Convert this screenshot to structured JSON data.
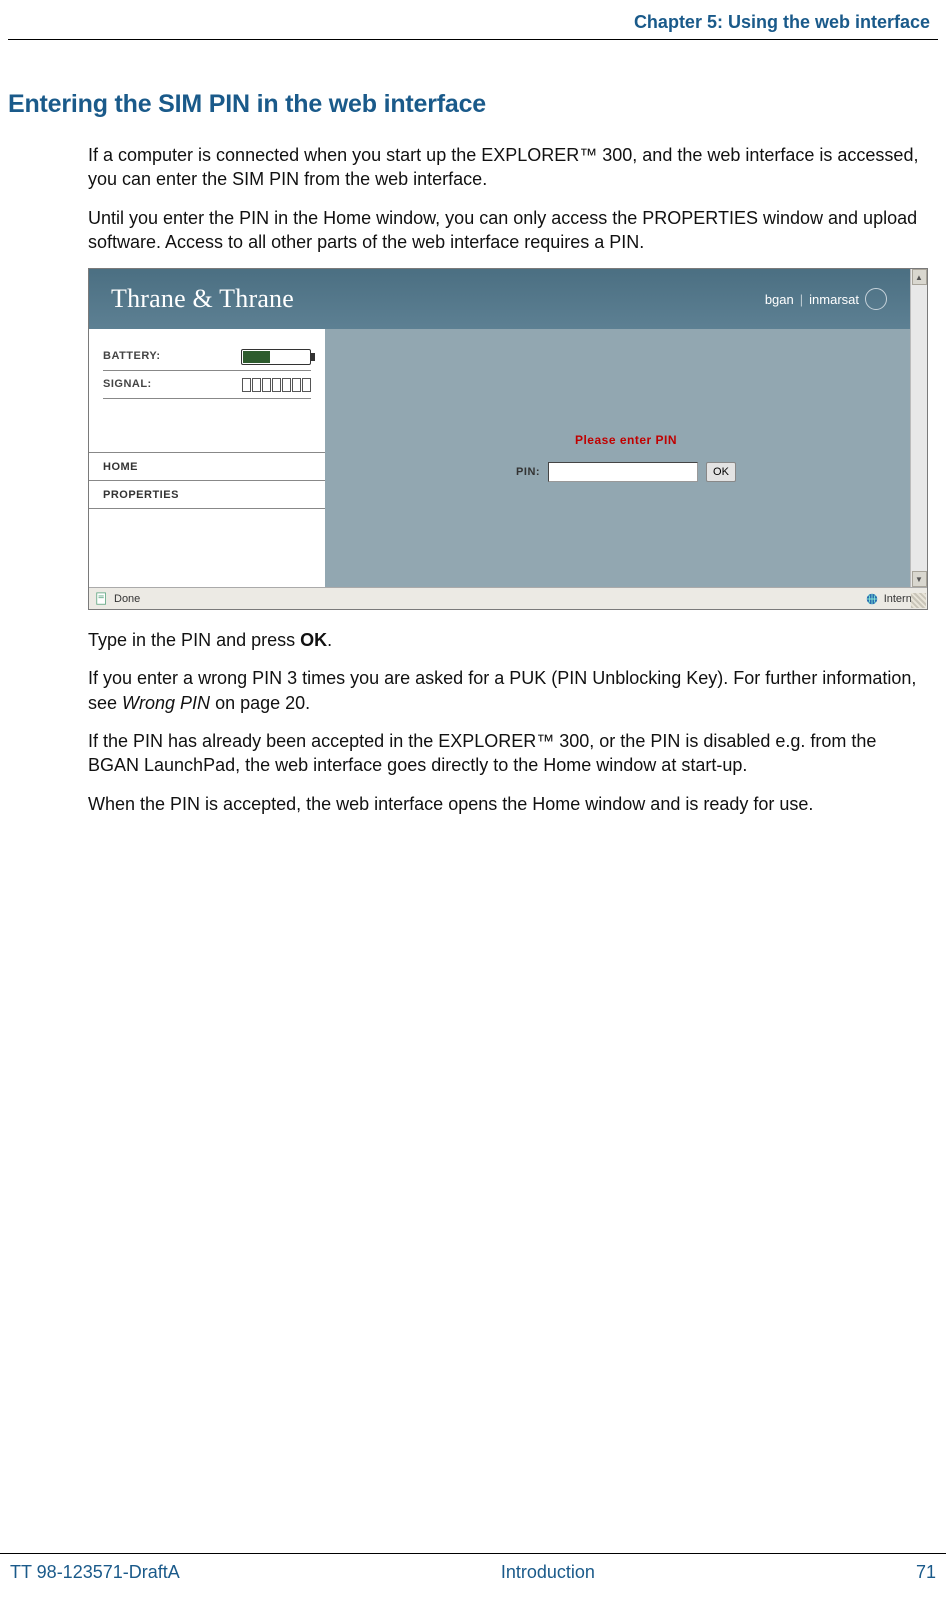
{
  "chapter_header": "Chapter 5: Using the web interface",
  "section_title": "Entering the SIM PIN in the web interface",
  "para1": "If a computer is connected when you start up the EXPLORER™ 300, and the web interface is accessed, you can enter the SIM PIN from the web interface.",
  "para2": "Until you enter the PIN in the Home window, you can only access the PROPERTIES window and upload software. Access to all other parts of the web interface requires a PIN.",
  "screenshot": {
    "brand": "Thrane & Thrane",
    "brandright_a": "bgan",
    "brandright_b": "inmarsat",
    "battery_label": "BATTERY:",
    "signal_label": "SIGNAL:",
    "nav_home": "HOME",
    "nav_properties": "PROPERTIES",
    "msg": "Please enter PIN",
    "pin_label": "PIN:",
    "ok_label": "OK",
    "status_done": "Done",
    "status_internet": "Internet"
  },
  "para3_a": "Type in the PIN and press ",
  "para3_b": "OK",
  "para3_c": ".",
  "para4_a": "If you enter a wrong PIN 3 times you are asked for a PUK (PIN Unblocking Key). For further information, see ",
  "para4_b": "Wrong PIN",
  "para4_c": " on page 20.",
  "para5": "If the PIN has already been accepted in the EXPLORER™ 300, or the PIN is disabled e.g. from the BGAN LaunchPad, the web interface goes directly to the Home window at start-up.",
  "para6": "When the PIN is accepted, the web interface opens the Home window and is ready for use.",
  "footer": {
    "left": "TT 98-123571-DraftA",
    "center": "Introduction",
    "right": "71"
  }
}
